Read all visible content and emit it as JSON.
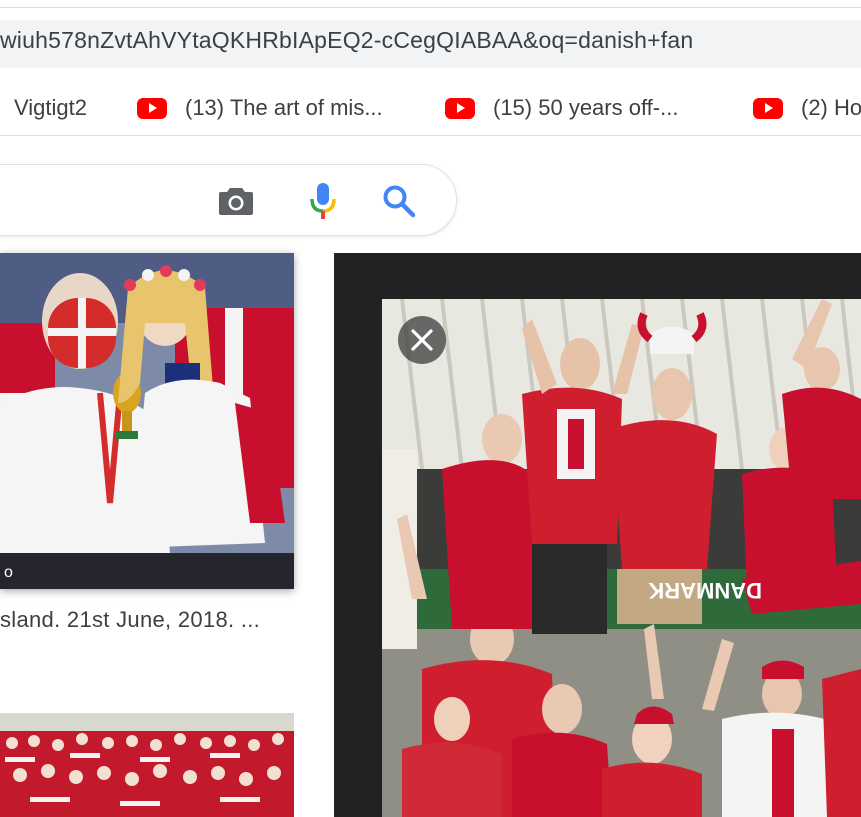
{
  "browser": {
    "url_fragment": "wiuh578nZvtAhVYtaQKHRbIApEQ2-cCegQIABAA&oq=danish+fan"
  },
  "bookmarks": [
    {
      "label": "Vigtigt2",
      "icon": ""
    },
    {
      "label": "(13) The art of mis...",
      "icon": "youtube-icon"
    },
    {
      "label": "(15) 50 years off-...",
      "icon": "youtube-icon"
    },
    {
      "label": "(2) Ho",
      "icon": "youtube-icon"
    }
  ],
  "search": {
    "icons": [
      "camera-icon",
      "microphone-icon",
      "search-icon"
    ]
  },
  "results": {
    "first_caption": "sland. 21st June, 2018. ...",
    "first_watermark": "o"
  },
  "preview": {
    "close_icon": "close-icon",
    "banner_text": "DANMARK"
  },
  "colors": {
    "google_blue": "#4285f4",
    "google_red": "#ea4335",
    "google_yellow": "#fbbc05",
    "google_green": "#34a853",
    "youtube_red": "#ff0000",
    "panel_bg": "#222222",
    "denmark_red": "#c8102e"
  }
}
